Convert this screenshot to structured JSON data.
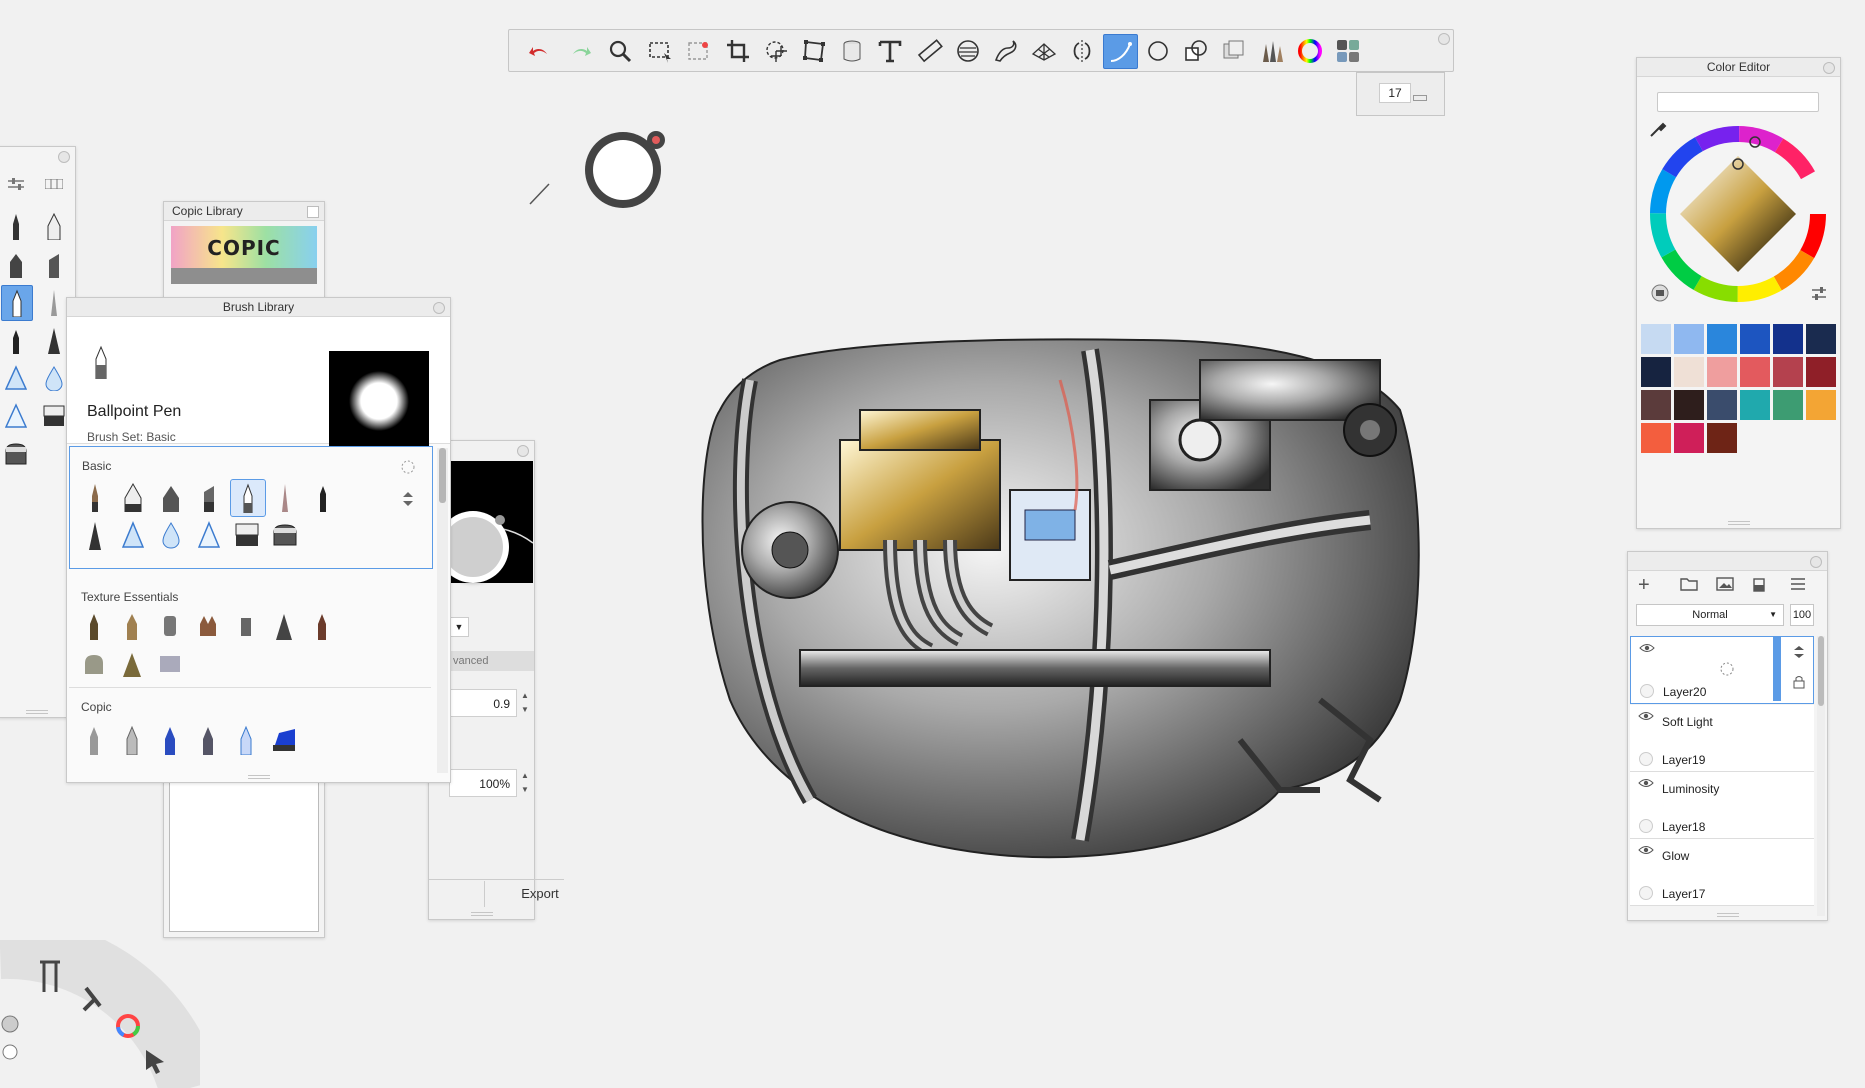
{
  "toolbar": {
    "tools": [
      "undo",
      "redo",
      "zoom",
      "rect-select",
      "magic-select",
      "crop",
      "transform",
      "distort",
      "bucket-fill",
      "text",
      "ruler",
      "ellipse-guide",
      "french-curve",
      "perspective",
      "symmetry",
      "stroke-tool",
      "shape-ellipse",
      "shape-tool",
      "layer-editor",
      "brush-library",
      "color-wheel",
      "lagoon"
    ],
    "active_tool": "stroke-tool",
    "brush_size": "17"
  },
  "copic_library": {
    "title": "Copic Library",
    "logo_text": "COPIC"
  },
  "brush_properties": {
    "value_1": "0.9",
    "value_2": "100%",
    "tab_label": "vanced",
    "export_label": "Export"
  },
  "brush_library": {
    "title": "Brush Library",
    "current_brush": "Ballpoint Pen",
    "brush_set": "Brush Set: Basic",
    "sections": [
      {
        "title": "Basic",
        "count": 13,
        "selected_index": 4
      },
      {
        "title": "Texture Essentials",
        "count": 10
      },
      {
        "title": "Copic",
        "count": 6
      }
    ]
  },
  "color_editor": {
    "title": "Color Editor",
    "hex_value": "",
    "swatches": [
      "#c6daf2",
      "#8fb8f0",
      "#2a86dc",
      "#1d55c0",
      "#13318c",
      "#1a2b4f",
      "#162340",
      "#efe0d6",
      "#ef9e9e",
      "#e35a5e",
      "#b4414e",
      "#8f1f28",
      "#5b3b3b",
      "#2e1e1c",
      "#3a4c6c",
      "#20a9ad",
      "#3d9c72",
      "#f3a534",
      "#f35e3e",
      "#cf1f59",
      "#6e2416"
    ]
  },
  "layers": {
    "blend_mode": "Normal",
    "opacity": "100",
    "items": [
      {
        "mode": "",
        "name": "Layer20",
        "selected": true
      },
      {
        "mode": "Soft Light",
        "name": "Layer19"
      },
      {
        "mode": "Luminosity",
        "name": "Layer18"
      },
      {
        "mode": "Glow",
        "name": "Layer17"
      }
    ]
  }
}
